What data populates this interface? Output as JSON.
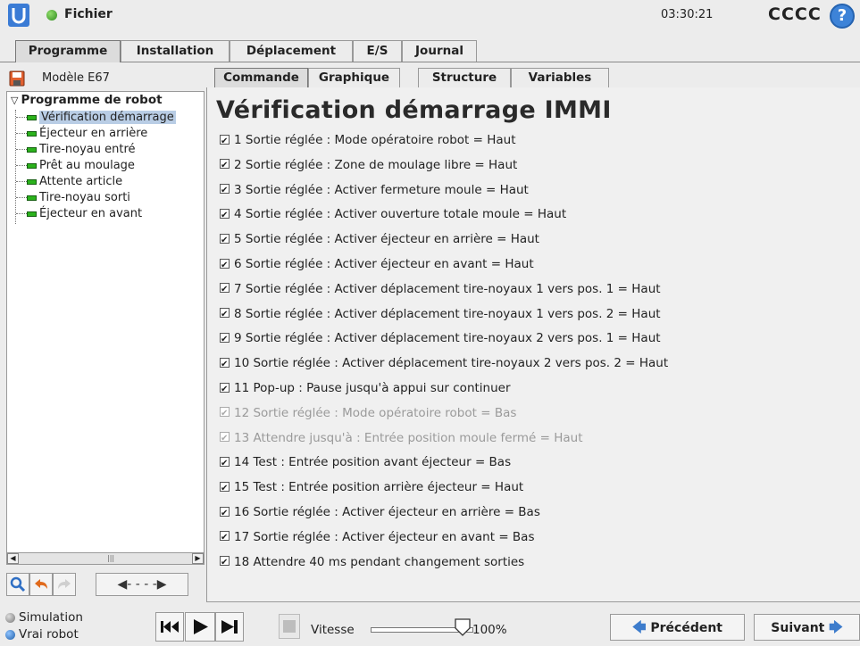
{
  "topbar": {
    "file_label": "Fichier",
    "clock": "03:30:21",
    "robot_name": "CCCC",
    "help_glyph": "?"
  },
  "main_tabs": [
    "Programme",
    "Installation",
    "Déplacement",
    "E/S",
    "Journal"
  ],
  "main_tab_active": "Programme",
  "left": {
    "model_name": "Modèle E67",
    "tree_root": "Programme de robot",
    "tree_items": [
      "Vérification démarrage",
      "Éjecteur en arrière",
      "Tire-noyau entré",
      "Prêt au moulage",
      "Attente article",
      "Tire-noyau sorti",
      "Éjecteur en avant"
    ],
    "selected_item": "Vérification démarrage"
  },
  "sub_tabs": [
    "Commande",
    "Graphique",
    "Structure",
    "Variables"
  ],
  "sub_tab_active": "Commande",
  "content": {
    "title": "Vérification démarrage IMMI",
    "rows": [
      {
        "text": "1 Sortie réglée : Mode opératoire robot = Haut",
        "enabled": true
      },
      {
        "text": "2 Sortie réglée : Zone de moulage libre = Haut",
        "enabled": true
      },
      {
        "text": "3 Sortie réglée : Activer fermeture moule = Haut",
        "enabled": true
      },
      {
        "text": "4 Sortie réglée : Activer ouverture totale moule = Haut",
        "enabled": true
      },
      {
        "text": "5 Sortie réglée : Activer éjecteur en arrière = Haut",
        "enabled": true
      },
      {
        "text": "6 Sortie réglée : Activer éjecteur en avant = Haut",
        "enabled": true
      },
      {
        "text": "7 Sortie réglée : Activer déplacement tire-noyaux 1 vers pos. 1 = Haut",
        "enabled": true
      },
      {
        "text": "8 Sortie réglée : Activer déplacement tire-noyaux 1 vers pos. 2 = Haut",
        "enabled": true
      },
      {
        "text": "9 Sortie réglée : Activer déplacement tire-noyaux 2 vers pos. 1 = Haut",
        "enabled": true
      },
      {
        "text": "10 Sortie réglée : Activer déplacement tire-noyaux 2 vers pos. 2 = Haut",
        "enabled": true
      },
      {
        "text": "11 Pop-up : Pause jusqu'à appui sur continuer",
        "enabled": true
      },
      {
        "text": "12 Sortie réglée : Mode opératoire robot = Bas",
        "enabled": false
      },
      {
        "text": "13 Attendre jusqu'à : Entrée position moule fermé = Haut",
        "enabled": false
      },
      {
        "text": "14 Test : Entrée position avant éjecteur = Bas",
        "enabled": true
      },
      {
        "text": "15 Test : Entrée position arrière éjecteur = Haut",
        "enabled": true
      },
      {
        "text": "16 Sortie réglée : Activer éjecteur en arrière = Bas",
        "enabled": true
      },
      {
        "text": "17 Sortie réglée : Activer éjecteur en avant = Bas",
        "enabled": true
      },
      {
        "text": "18 Attendre 40 ms pendant changement sorties",
        "enabled": true
      }
    ]
  },
  "bottom": {
    "simulation_label": "Simulation",
    "real_robot_label": "Vrai robot",
    "speed_label": "Vitesse",
    "speed_value": "100%",
    "speed_fraction": 1.0,
    "prev_label": "Précédent",
    "next_label": "Suivant"
  },
  "colors": {
    "accent_blue": "#3d83d8",
    "node_green": "#2bb21c",
    "selection": "#b9cde5",
    "disabled_text": "#9a9a9a"
  },
  "icons": [
    "ur-logo-icon",
    "status-dot-icon",
    "help-icon",
    "save-icon",
    "search-icon",
    "undo-icon",
    "redo-icon",
    "move-arrows-icon",
    "skip-back-icon",
    "play-icon",
    "step-forward-icon",
    "stop-icon",
    "arrow-left-icon",
    "arrow-right-icon"
  ]
}
